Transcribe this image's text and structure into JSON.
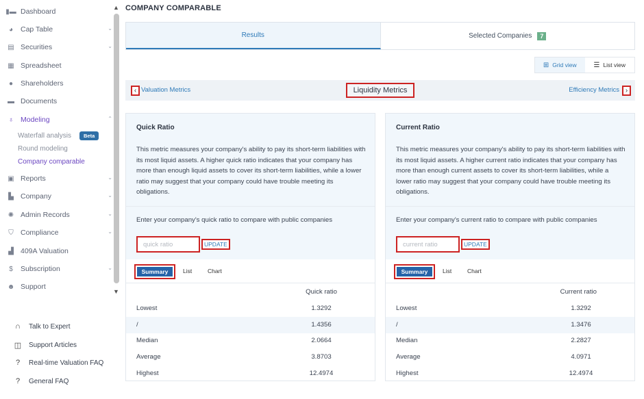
{
  "sidebar": {
    "items": [
      {
        "label": "Dashboard",
        "icon": "dashboard-icon",
        "chevron": false
      },
      {
        "label": "Cap Table",
        "icon": "pie-chart-icon",
        "chevron": true
      },
      {
        "label": "Securities",
        "icon": "clipboard-icon",
        "chevron": true
      },
      {
        "label": "Spreadsheet",
        "icon": "grid-icon",
        "chevron": false
      },
      {
        "label": "Shareholders",
        "icon": "user-icon",
        "chevron": false
      },
      {
        "label": "Documents",
        "icon": "folder-icon",
        "chevron": false
      },
      {
        "label": "Modeling",
        "icon": "lightbulb-icon",
        "chevron": true,
        "active": true
      },
      {
        "label": "Reports",
        "icon": "report-icon",
        "chevron": true
      },
      {
        "label": "Company",
        "icon": "building-icon",
        "chevron": true
      },
      {
        "label": "Admin Records",
        "icon": "gear-icon",
        "chevron": true
      },
      {
        "label": "Compliance",
        "icon": "shield-icon",
        "chevron": true
      },
      {
        "label": "409A Valuation",
        "icon": "bar-chart-icon",
        "chevron": false
      },
      {
        "label": "Subscription",
        "icon": "dollar-icon",
        "chevron": true
      },
      {
        "label": "Support",
        "icon": "support-icon",
        "chevron": false
      }
    ],
    "modeling_sub": {
      "waterfall": "Waterfall analysis",
      "beta": "Beta",
      "round": "Round modeling",
      "company_comparable": "Company comparable"
    },
    "footer": [
      {
        "label": "Talk to Expert",
        "icon": "headset-icon"
      },
      {
        "label": "Support Articles",
        "icon": "book-icon"
      },
      {
        "label": "Real-time Valuation FAQ",
        "icon": "help-icon"
      },
      {
        "label": "General FAQ",
        "icon": "help-icon"
      }
    ]
  },
  "page": {
    "title": "COMPANY COMPARABLE",
    "tabs": {
      "results": "Results",
      "selected": "Selected Companies",
      "selected_count": "7"
    },
    "view": {
      "grid": "Grid view",
      "list": "List view"
    },
    "metrics": {
      "prev": "Valuation Metrics",
      "current": "Liquidity Metrics",
      "next": "Efficiency Metrics"
    }
  },
  "cards": [
    {
      "title": "Quick Ratio",
      "description": "This metric measures your company's ability to pay its short-term liabilities with its most liquid assets. A higher quick ratio indicates that your company has more than enough liquid assets to cover its short-term liabilities, while a lower ratio may suggest that your company could have trouble meeting its obligations.",
      "prompt": "Enter your company's quick ratio to compare with public companies",
      "placeholder": "quick ratio",
      "update": "UPDATE",
      "subtabs": {
        "summary": "Summary",
        "list": "List",
        "chart": "Chart"
      },
      "column": "Quick ratio",
      "rows": [
        {
          "label": "Lowest",
          "value": "1.3292"
        },
        {
          "label": "/",
          "value": "1.4356"
        },
        {
          "label": "Median",
          "value": "2.0664"
        },
        {
          "label": "Average",
          "value": "3.8703"
        },
        {
          "label": "Highest",
          "value": "12.4974"
        }
      ]
    },
    {
      "title": "Current Ratio",
      "description": "This metric measures your company's ability to pay its short-term liabilities with its most liquid assets. A higher current ratio indicates that your company has more than enough current assets to cover its short-term liabilities, while a lower ratio may suggest that your company could have trouble meeting its obligations.",
      "prompt": "Enter your company's current ratio to compare with public companies",
      "placeholder": "current ratio",
      "update": "UPDATE",
      "subtabs": {
        "summary": "Summary",
        "list": "List",
        "chart": "Chart"
      },
      "column": "Current ratio",
      "rows": [
        {
          "label": "Lowest",
          "value": "1.3292"
        },
        {
          "label": "/",
          "value": "1.3476"
        },
        {
          "label": "Median",
          "value": "2.2827"
        },
        {
          "label": "Average",
          "value": "4.0971"
        },
        {
          "label": "Highest",
          "value": "12.4974"
        }
      ]
    }
  ]
}
